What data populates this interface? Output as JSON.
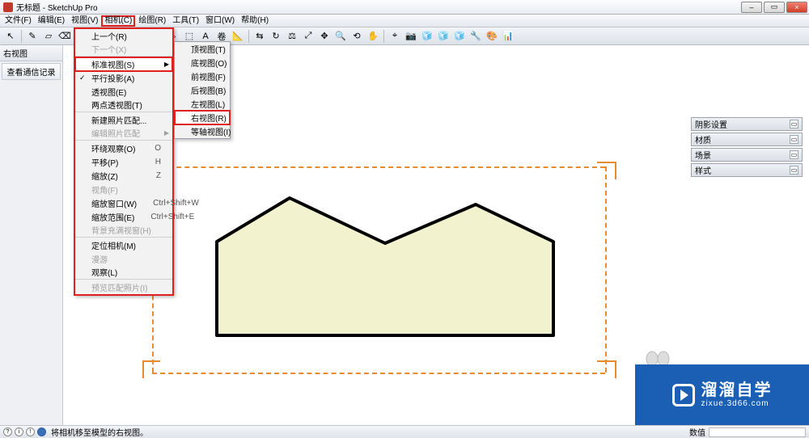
{
  "window": {
    "title": "无标题 - SketchUp Pro",
    "min": "–",
    "max": "▭",
    "close": "×"
  },
  "menubar": {
    "items": [
      "文件(F)",
      "编辑(E)",
      "视图(V)",
      "相机(C)",
      "绘图(R)",
      "工具(T)",
      "窗口(W)",
      "帮助(H)"
    ],
    "highlight_index": 3
  },
  "toolbar_icons": [
    "↖",
    "✎",
    "▱",
    "⌫",
    "／",
    "⌒",
    "□",
    "○",
    "⬠",
    "⇔",
    "⬚",
    "A",
    "卷",
    "📐",
    "⇆",
    "↻",
    "⚖",
    "⤢",
    "✥",
    "🔍",
    "⟲",
    "✋",
    "⌖",
    "📷",
    "🧊",
    "🧊",
    "🧊",
    "🔧",
    "🎨",
    "📊"
  ],
  "left_panel": {
    "title": "右视图",
    "button": "查看通信记录"
  },
  "camera_menu": {
    "items": [
      {
        "label": "上一个(R)"
      },
      {
        "label": "下一个(X)",
        "disabled": true,
        "sep": true
      },
      {
        "label": "标准视图(S)",
        "arrow": true,
        "highlight": true
      },
      {
        "label": "平行投影(A)",
        "checked": true
      },
      {
        "label": "透视图(E)"
      },
      {
        "label": "两点透视图(T)",
        "sep": true
      },
      {
        "label": "新建照片匹配..."
      },
      {
        "label": "编辑照片匹配",
        "arrow": true,
        "disabled": true,
        "sep": true
      },
      {
        "label": "环绕观察(O)",
        "shortcut": "O"
      },
      {
        "label": "平移(P)",
        "shortcut": "H"
      },
      {
        "label": "缩放(Z)",
        "shortcut": "Z"
      },
      {
        "label": "视角(F)",
        "disabled": true
      },
      {
        "label": "缩放窗口(W)",
        "shortcut": "Ctrl+Shift+W"
      },
      {
        "label": "缩放范围(E)",
        "shortcut": "Ctrl+Shift+E"
      },
      {
        "label": "背景充满视窗(H)",
        "disabled": true,
        "sep": true
      },
      {
        "label": "定位相机(M)"
      },
      {
        "label": "漫游",
        "disabled": true
      },
      {
        "label": "观察(L)",
        "sep": true
      },
      {
        "label": "预览匹配照片(I)",
        "disabled": true
      }
    ]
  },
  "views_submenu": {
    "items": [
      {
        "label": "顶视图(T)"
      },
      {
        "label": "底视图(O)"
      },
      {
        "label": "前视图(F)"
      },
      {
        "label": "后视图(B)"
      },
      {
        "label": "左视图(L)"
      },
      {
        "label": "右视图(R)",
        "highlight": true
      },
      {
        "label": "等轴视图(I)"
      }
    ]
  },
  "float_panels": [
    "阴影设置",
    "材质",
    "场景",
    "样式"
  ],
  "statusbar": {
    "hint": "将相机移至模型的右视图。",
    "value_label": "数值"
  },
  "watermark": {
    "main": "溜溜自学",
    "sub": "zixue.3d66.com"
  },
  "colors": {
    "accent_red": "#e02020",
    "guide_orange": "#e88b2e",
    "shape_fill": "#f3f2cf",
    "watermark_bg": "#1a5fb4"
  }
}
